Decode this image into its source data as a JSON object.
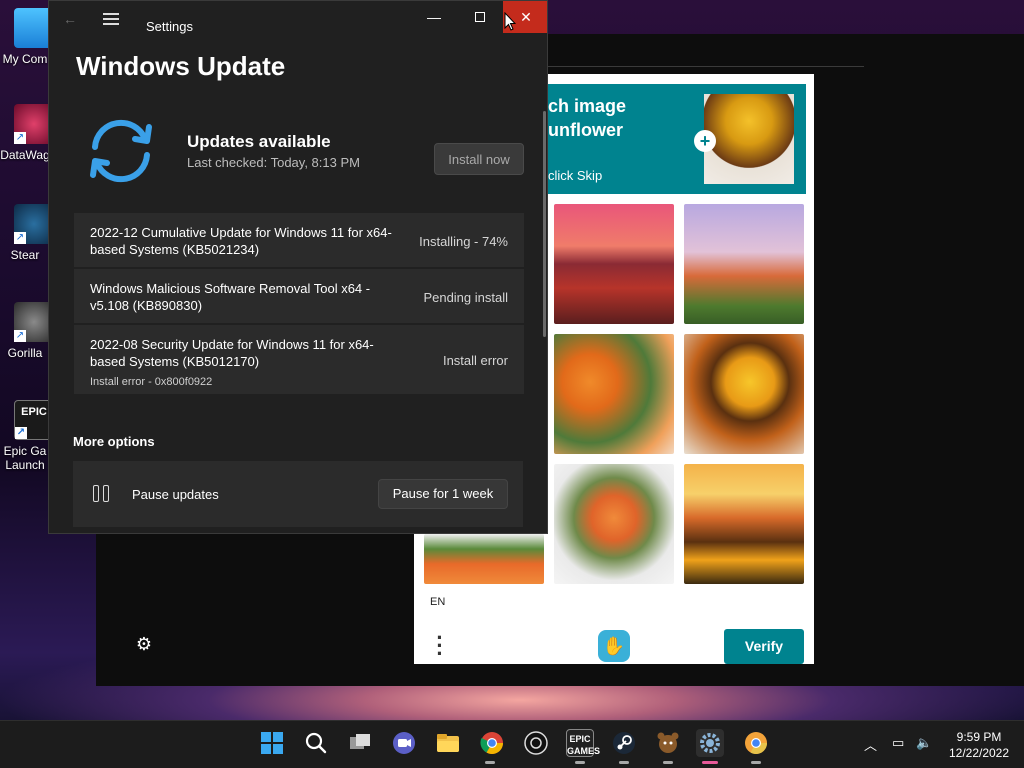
{
  "desktop": {
    "icons": [
      {
        "label": "My Com"
      },
      {
        "label": "DataWag"
      },
      {
        "label": "Stear"
      },
      {
        "label": "Gorilla"
      },
      {
        "label": "Epic Ga\nLaunch"
      }
    ]
  },
  "settings": {
    "window_title": "Settings",
    "page_title": "Windows Update",
    "status_title": "Updates available",
    "last_checked": "Last checked: Today, 8:13 PM",
    "install_now": "Install now",
    "updates": [
      {
        "name": "2022-12 Cumulative Update for Windows 11 for x64-based Systems (KB5021234)",
        "status": "Installing - 74%"
      },
      {
        "name": "Windows Malicious Software Removal Tool x64 - v5.108 (KB890830)",
        "status": "Pending install"
      },
      {
        "name": "2022-08 Security Update for Windows 11 for x64-based Systems (KB5012170)",
        "status": "Install error",
        "error": "Install error - 0x800f0922"
      }
    ],
    "more_options": "More options",
    "pause_label": "Pause updates",
    "pause_button": "Pause for 1 week"
  },
  "captcha": {
    "header_line1": "ch image",
    "header_line2": "unflower",
    "header_line3": "click Skip",
    "lang": "EN",
    "verify": "Verify",
    "accent": "#00838f"
  },
  "taskbar": {
    "time": "9:59 PM",
    "date": "12/22/2022",
    "apps": [
      "windows-start",
      "search",
      "task-view",
      "meet",
      "file-explorer",
      "chrome",
      "epic-alt",
      "epic-games",
      "steam",
      "bear-app",
      "settings",
      "chrome-canary"
    ]
  }
}
